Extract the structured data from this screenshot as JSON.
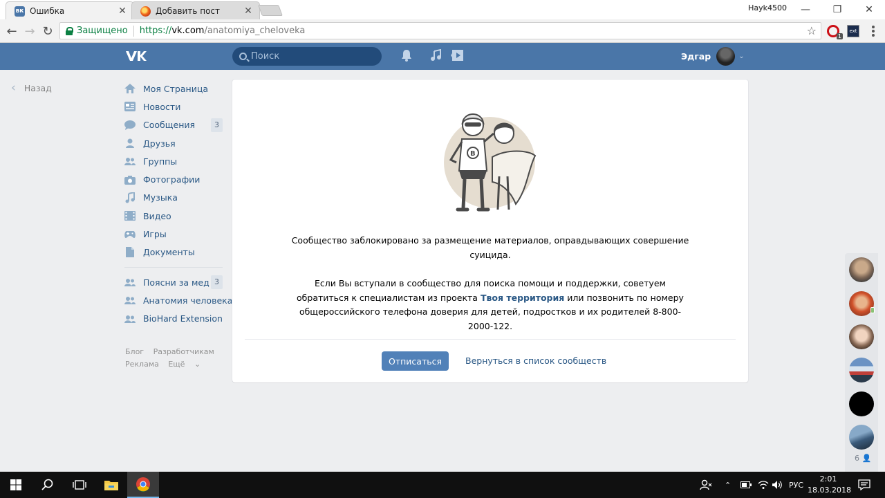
{
  "browser": {
    "tabs": [
      {
        "title": "Ошибка",
        "close": "✕"
      },
      {
        "title": "Добавить пост",
        "close": "✕"
      }
    ],
    "window_user": "Hayk4500",
    "window_controls": {
      "minimize": "—",
      "restore": "❐",
      "close": "✕"
    },
    "address": {
      "secure_label": "Защищено",
      "scheme": "https://",
      "host": "vk.com",
      "path": "/anatomiya_cheloveka"
    },
    "extension_badge": "1"
  },
  "vk_header": {
    "logo": "VK",
    "search_placeholder": "Поиск",
    "user_name": "Эдгар"
  },
  "back_link": "Назад",
  "sidebar": {
    "items": [
      {
        "label": "Моя Страница",
        "icon": "home-icon"
      },
      {
        "label": "Новости",
        "icon": "news-icon"
      },
      {
        "label": "Сообщения",
        "icon": "messages-icon",
        "badge": "3"
      },
      {
        "label": "Друзья",
        "icon": "friends-icon"
      },
      {
        "label": "Группы",
        "icon": "groups-icon"
      },
      {
        "label": "Фотографии",
        "icon": "camera-icon"
      },
      {
        "label": "Музыка",
        "icon": "music-icon"
      },
      {
        "label": "Видео",
        "icon": "video-icon"
      },
      {
        "label": "Игры",
        "icon": "gamepad-icon"
      },
      {
        "label": "Документы",
        "icon": "document-icon"
      }
    ],
    "groups": [
      {
        "label": "Поясни за мед",
        "badge": "3"
      },
      {
        "label": "Анатомия человека"
      },
      {
        "label": "BioHard Extension"
      }
    ],
    "footer": [
      "Блог",
      "Разработчикам",
      "Реклама",
      "Ещё"
    ]
  },
  "card": {
    "message_blocked": "Сообщество заблокировано за размещение материалов, оправдывающих совершение суицида.",
    "message_help_before": "Если Вы вступали в сообщество для поиска помощи и поддержки, советуем обратиться к специалистам из проекта ",
    "message_help_link": "Твоя территория",
    "message_help_after": " или позвонить по номеру общероссийского телефона доверия для детей, подростков и их родителей 8-800-2000-122.",
    "unsubscribe_button": "Отписаться",
    "back_to_list_link": "Вернуться в список сообществ"
  },
  "chat_strip": {
    "count": "6"
  },
  "taskbar": {
    "tray_lang": "РУС",
    "time": "2:01",
    "date": "18.03.2018"
  },
  "colors": {
    "vk_blue": "#4a76a8",
    "link": "#2a5885",
    "button": "#5181b8",
    "page_bg": "#edeef0",
    "secure_green": "#0b8043"
  }
}
